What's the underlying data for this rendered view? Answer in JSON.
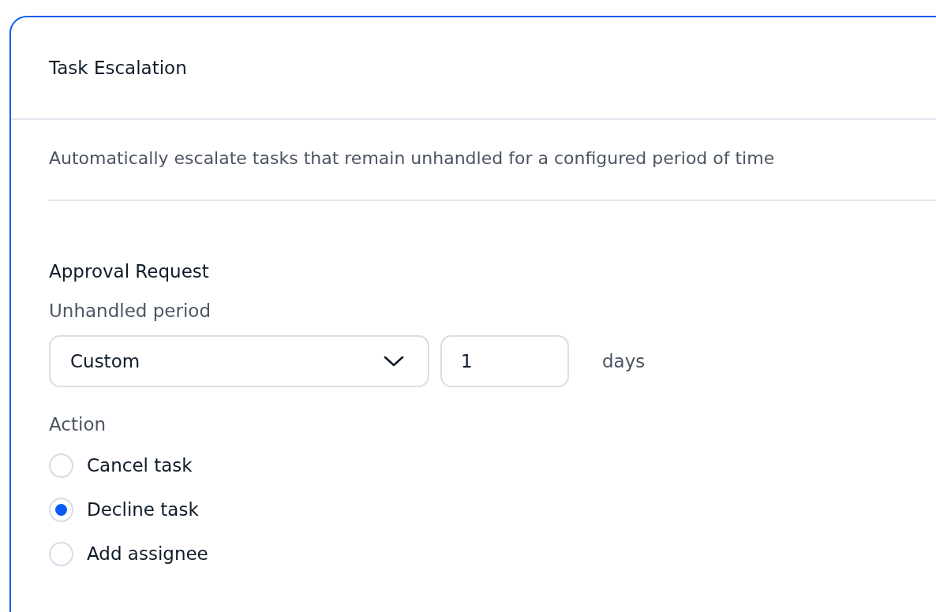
{
  "card": {
    "title": "Task Escalation",
    "description": "Automatically escalate tasks that remain unhandled for a configured period of time"
  },
  "section": {
    "title": "Approval Request",
    "period_label": "Unhandled period",
    "period_select": {
      "value": "Custom"
    },
    "period_amount": {
      "value": "1"
    },
    "period_unit": "days",
    "action_label": "Action",
    "actions": [
      {
        "label": "Cancel task",
        "selected": false
      },
      {
        "label": "Decline task",
        "selected": true
      },
      {
        "label": "Add assignee",
        "selected": false
      }
    ]
  }
}
